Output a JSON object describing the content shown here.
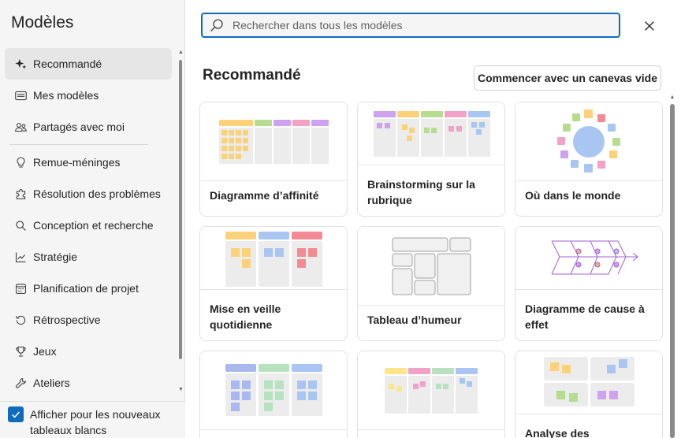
{
  "sidebar": {
    "title": "Modèles",
    "items": [
      {
        "label": "Recommandé",
        "icon": "sparkle-icon"
      },
      {
        "label": "Mes modèles",
        "icon": "board-icon"
      },
      {
        "label": "Partagés avec moi",
        "icon": "people-icon"
      },
      {
        "label": "Remue-méninges",
        "icon": "lightbulb-icon"
      },
      {
        "label": "Résolution des problèmes",
        "icon": "puzzle-icon"
      },
      {
        "label": "Conception et recherche",
        "icon": "search-icon"
      },
      {
        "label": "Stratégie",
        "icon": "chart-icon"
      },
      {
        "label": "Planification de projet",
        "icon": "calendar-icon"
      },
      {
        "label": "Rétrospective",
        "icon": "history-icon"
      },
      {
        "label": "Jeux",
        "icon": "trophy-icon"
      },
      {
        "label": "Ateliers",
        "icon": "wrench-icon"
      }
    ],
    "footer": {
      "label": "Afficher pour les nouveaux tableaux blancs",
      "checked": true
    }
  },
  "search": {
    "placeholder": "Rechercher dans tous les modèles"
  },
  "main": {
    "section_title": "Recommandé",
    "blank_canvas_label": "Commencer avec un canevas vide",
    "cards": [
      {
        "label": "Diagramme d’affinité"
      },
      {
        "label": "Brainstorming sur la rubrique"
      },
      {
        "label": "Où dans le monde"
      },
      {
        "label": "Mise en veille quotidienne"
      },
      {
        "label": "Tableau d’humeur"
      },
      {
        "label": "Diagramme de cause à effet"
      },
      {
        "label": ""
      },
      {
        "label": ""
      },
      {
        "label": "Analyse des"
      }
    ]
  },
  "colors": {
    "accent": "#0f6cbd",
    "yellow": "#fbd27a",
    "green": "#b5dc8f",
    "pink": "#f2a1c7",
    "purple": "#cfa2ef",
    "blue": "#a9c6f2",
    "red": "#f28b93",
    "lightgray": "#ececec"
  }
}
